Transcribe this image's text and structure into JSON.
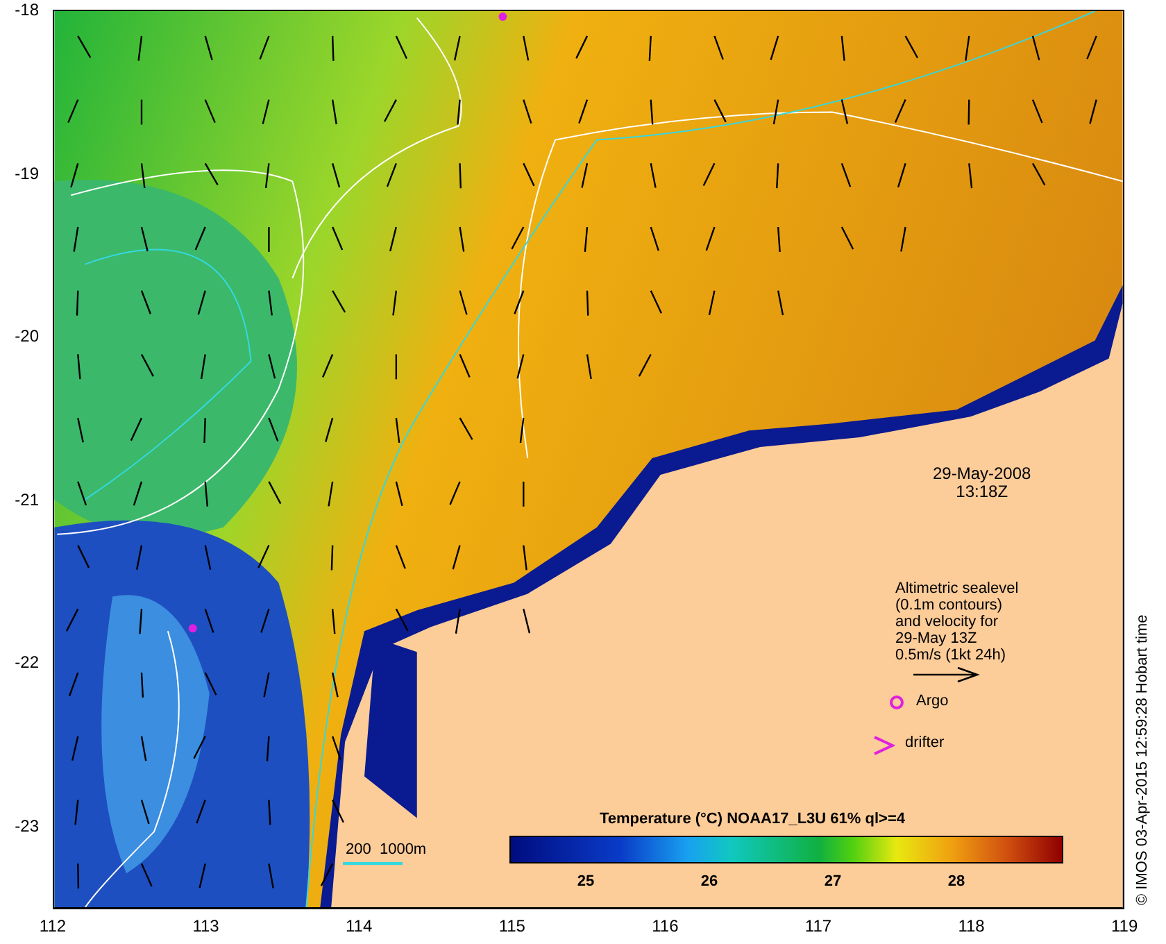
{
  "y_axis": {
    "ticks": [
      "-18",
      "-19",
      "-20",
      "-21",
      "-22",
      "-23"
    ]
  },
  "x_axis": {
    "ticks": [
      "112",
      "113",
      "114",
      "115",
      "116",
      "117",
      "118",
      "119"
    ]
  },
  "map": {
    "date": "29-May-2008",
    "time": "13:18Z"
  },
  "legend": {
    "lines": [
      "Altimetric sealevel",
      "(0.1m contours)",
      "and velocity for",
      "29-May 13Z",
      "0.5m/s (1kt 24h)"
    ],
    "argo_label": "Argo",
    "drifter_label": "drifter"
  },
  "depth_legend": {
    "label": "200  1000m"
  },
  "colorbar": {
    "title": "Temperature (°C) NOAA17_L3U 61% ql>=4",
    "ticks": [
      "25",
      "26",
      "27",
      "28"
    ]
  },
  "credit": "© IMOS 03-Apr-2015 12:59:28 Hobart time"
}
